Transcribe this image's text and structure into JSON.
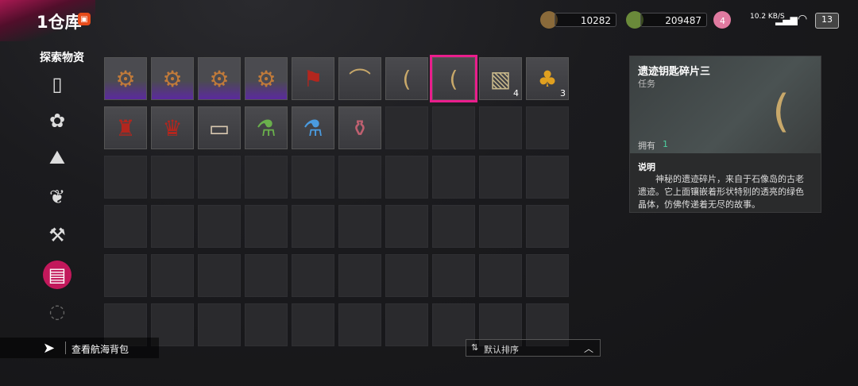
{
  "header": {
    "title": "1仓库",
    "badge_icon": "red-chest-icon"
  },
  "currencies": [
    {
      "icon": "chest-icon",
      "value": "10282"
    },
    {
      "icon": "frog-coin-icon",
      "value": "209487"
    }
  ],
  "status": {
    "network_speed": "10.2 KB/S",
    "battery": "13",
    "plus_badge": "4"
  },
  "sidebar": {
    "section_label": "探索物资",
    "items": [
      {
        "name": "frame-icon",
        "glyph": "▯"
      },
      {
        "name": "flower-icon",
        "glyph": "✿"
      },
      {
        "name": "mountain-icon",
        "glyph": "⛰"
      },
      {
        "name": "herb-icon",
        "glyph": "❦"
      },
      {
        "name": "shovel-icon",
        "glyph": "⚒"
      },
      {
        "name": "map-icon",
        "glyph": "▤",
        "active": true
      },
      {
        "name": "scroll-more-icon",
        "glyph": "◌",
        "dim": true
      }
    ]
  },
  "grid": {
    "items": [
      {
        "name": "gear-shield-item",
        "glyph": "⚙",
        "color": "#c07a3a",
        "rarity": "purple"
      },
      {
        "name": "gear-shield-item",
        "glyph": "⚙",
        "color": "#c07a3a",
        "rarity": "purple"
      },
      {
        "name": "gear-shield-item",
        "glyph": "⚙",
        "color": "#c07a3a",
        "rarity": "purple"
      },
      {
        "name": "gear-shield-item",
        "glyph": "⚙",
        "color": "#c07a3a",
        "rarity": "purple"
      },
      {
        "name": "red-banner-item",
        "glyph": "⚑",
        "color": "#b3261e"
      },
      {
        "name": "relic-fragment-item",
        "glyph": "⌒",
        "color": "#c8a86a"
      },
      {
        "name": "relic-fragment-item",
        "glyph": "(",
        "color": "#c8a86a"
      },
      {
        "name": "relic-fragment-item",
        "glyph": "(",
        "color": "#c8a86a",
        "selected": true
      },
      {
        "name": "treasure-map-item",
        "glyph": "▧",
        "color": "#c8b88a",
        "count": "4"
      },
      {
        "name": "pineapple-item",
        "glyph": "♣",
        "color": "#e0a020",
        "count": "3"
      },
      {
        "name": "red-cloth-item",
        "glyph": "♜",
        "color": "#b3261e"
      },
      {
        "name": "red-cloth-item",
        "glyph": "♛",
        "color": "#b3261e"
      },
      {
        "name": "paper-scrap-item",
        "glyph": "▭",
        "color": "#d8c8b0"
      },
      {
        "name": "green-potion-item",
        "glyph": "⚗",
        "color": "#6ab04c"
      },
      {
        "name": "blue-potion-item",
        "glyph": "⚗",
        "color": "#4a9be0"
      },
      {
        "name": "red-bottle-item",
        "glyph": "⚱",
        "color": "#c06070"
      }
    ],
    "total_slots": 60
  },
  "detail": {
    "name": "遗迹钥匙碎片三",
    "type": "任务",
    "own_label": "拥有",
    "own_value": "1",
    "desc_label": "说明",
    "desc_text": "神秘的遗迹碎片，来自于石像岛的古老遗迹。它上面镶嵌着形状特别的透亮的绿色晶体，仿佛传递着无尽的故事。"
  },
  "bottom": {
    "backpack_label": "查看航海背包",
    "sort_label": "默认排序"
  },
  "colors": {
    "accent": "#e91e8c",
    "own_count": "#4dd0a0"
  }
}
